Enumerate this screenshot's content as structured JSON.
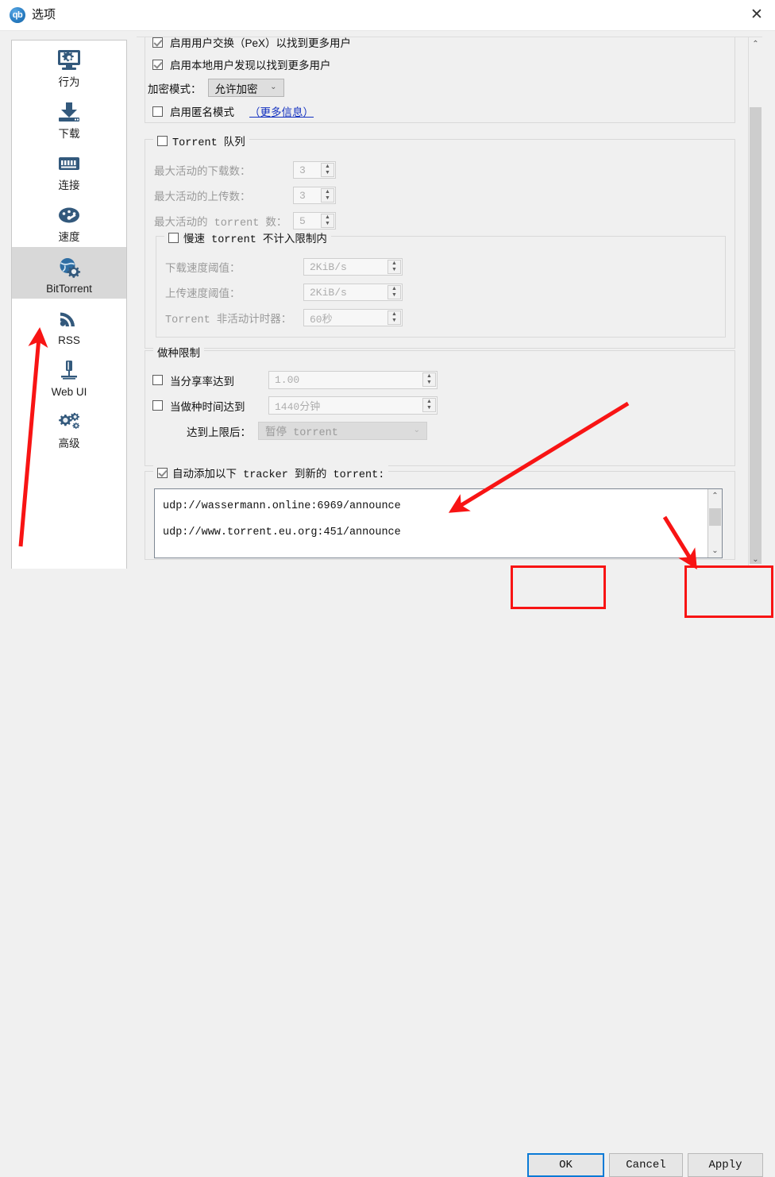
{
  "window": {
    "app_icon": "qb",
    "title": "选项",
    "close_icon": "close-icon"
  },
  "sidebar": {
    "items": [
      {
        "label": "行为",
        "icon": "monitor-gear-icon",
        "selected": false
      },
      {
        "label": "下载",
        "icon": "download-icon",
        "selected": false
      },
      {
        "label": "连接",
        "icon": "network-icon",
        "selected": false
      },
      {
        "label": "速度",
        "icon": "speedometer-icon",
        "selected": false
      },
      {
        "label": "BitTorrent",
        "icon": "globe-gear-icon",
        "selected": true
      },
      {
        "label": "RSS",
        "icon": "rss-icon",
        "selected": false
      },
      {
        "label": "Web UI",
        "icon": "server-icon",
        "selected": false
      },
      {
        "label": "高级",
        "icon": "gears-icon",
        "selected": false
      }
    ]
  },
  "privacy": {
    "pex_label": "启用用户交换（PeX）以找到更多用户",
    "pex_checked": true,
    "lsd_label": "启用本地用户发现以找到更多用户",
    "lsd_checked": true,
    "encryption_label": "加密模式：",
    "encryption_value": "允许加密",
    "anonymous_label": "启用匿名模式",
    "anonymous_checked": false,
    "more_info_link": "（更多信息）"
  },
  "queue": {
    "legend": "Torrent 队列",
    "enabled": false,
    "rows": [
      {
        "label": "最大活动的下载数：",
        "value": "3"
      },
      {
        "label": "最大活动的上传数：",
        "value": "3"
      },
      {
        "label": "最大活动的 torrent 数：",
        "value": "5"
      }
    ],
    "slow": {
      "legend": "慢速 torrent 不计入限制内",
      "enabled": false,
      "rows": [
        {
          "label": "下载速度阈值：",
          "value": "2KiB/s"
        },
        {
          "label": "上传速度阈值：",
          "value": "2KiB/s"
        },
        {
          "label": "Torrent 非活动计时器：",
          "value": "60秒"
        }
      ]
    }
  },
  "seeding": {
    "legend": "做种限制",
    "ratio_label": "当分享率达到",
    "ratio_checked": false,
    "ratio_value": "1.00",
    "time_label": "当做种时间达到",
    "time_checked": false,
    "time_value": "1440分钟",
    "action_label": "达到上限后：",
    "action_value": "暂停 torrent"
  },
  "trackers": {
    "legend": "自动添加以下 tracker 到新的 torrent:",
    "checked": true,
    "lines": [
      "udp://wassermann.online:6969/announce",
      "udp://www.torrent.eu.org:451/announce"
    ]
  },
  "buttons": {
    "ok": "OK",
    "cancel": "Cancel",
    "apply": "Apply"
  },
  "scrollbars": {
    "up_arrow": "⌃",
    "down_arrow": "⌄"
  },
  "annotations": {
    "highlight_color": "#f81414",
    "focus_color": "#0a7ad6"
  }
}
